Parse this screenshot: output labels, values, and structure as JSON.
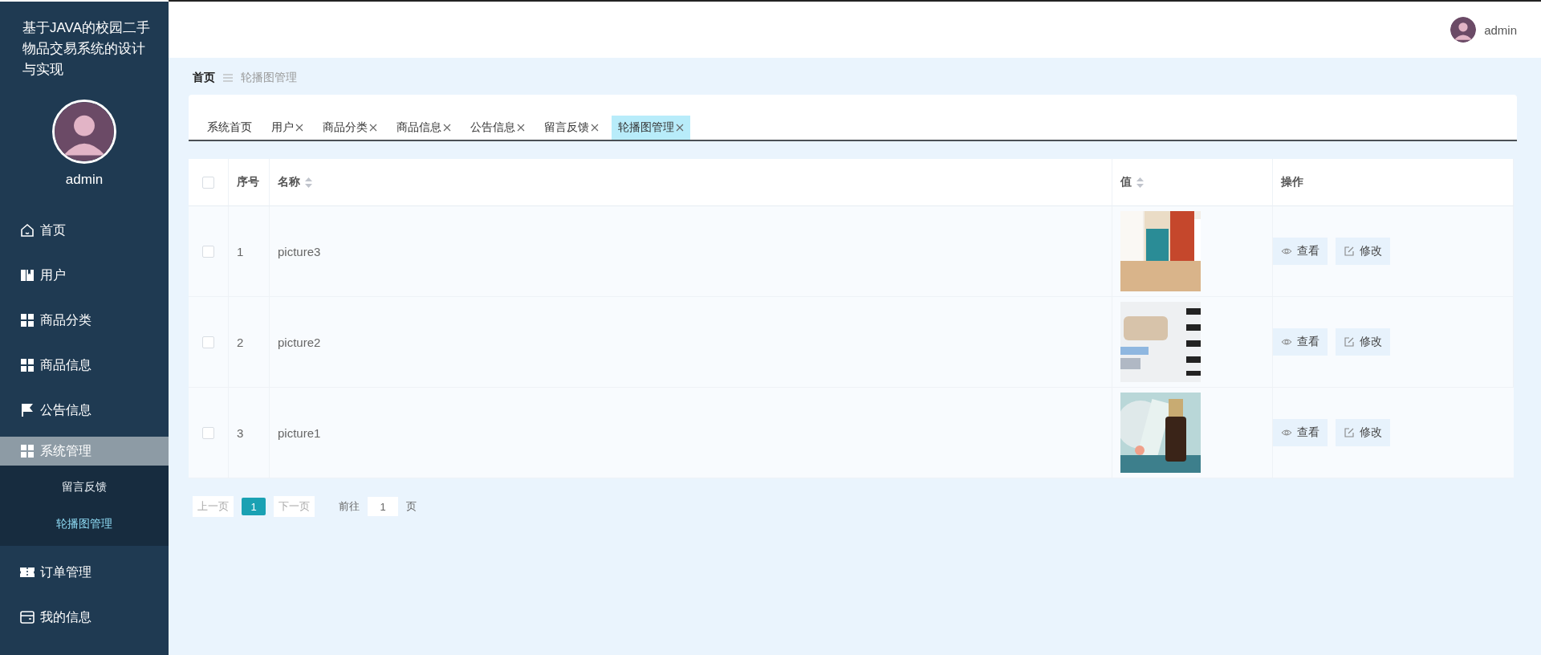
{
  "sidebar": {
    "title": "基于JAVA的校园二手物品交易系统的设计与实现",
    "user": {
      "name": "admin"
    },
    "menu": [
      {
        "label": "首页",
        "kind": "home",
        "selected": false
      },
      {
        "label": "用户",
        "kind": "book",
        "selected": false
      },
      {
        "label": "商品分类",
        "kind": "grid",
        "selected": false
      },
      {
        "label": "商品信息",
        "kind": "grid",
        "selected": false
      },
      {
        "label": "公告信息",
        "kind": "flag",
        "selected": false
      },
      {
        "label": "系统管理",
        "kind": "grid",
        "selected": true,
        "expanded": true,
        "children": [
          {
            "label": "留言反馈",
            "selected": false
          },
          {
            "label": "轮播图管理",
            "selected": true
          }
        ]
      },
      {
        "label": "订单管理",
        "kind": "ticket",
        "selected": false
      },
      {
        "label": "我的信息",
        "kind": "card",
        "selected": false
      }
    ]
  },
  "header": {
    "user": "admin"
  },
  "breadcrumb": [
    "首页",
    "轮播图管理"
  ],
  "tabs": [
    {
      "label": "系统首页",
      "closable": false,
      "selected": false
    },
    {
      "label": "用户",
      "closable": true,
      "selected": false
    },
    {
      "label": "商品分类",
      "closable": true,
      "selected": false
    },
    {
      "label": "商品信息",
      "closable": true,
      "selected": false
    },
    {
      "label": "公告信息",
      "closable": true,
      "selected": false
    },
    {
      "label": "留言反馈",
      "closable": true,
      "selected": false
    },
    {
      "label": "轮播图管理",
      "closable": true,
      "selected": true
    }
  ],
  "table": {
    "select_all": {
      "checked": false
    },
    "columns": [
      {
        "label": "序号",
        "sortable": false
      },
      {
        "label": "名称",
        "sortable": true
      },
      {
        "label": "值",
        "sortable": true
      },
      {
        "label": "操作",
        "sortable": false
      }
    ],
    "rows": [
      {
        "checked": false,
        "index": "1",
        "name": "picture3",
        "value": {
          "kind": "picture"
        },
        "actions": [
          {
            "kind": "view",
            "label": "查看"
          },
          {
            "kind": "edit",
            "label": "修改"
          }
        ]
      },
      {
        "checked": false,
        "index": "2",
        "name": "picture2",
        "value": {
          "kind": "picture"
        },
        "actions": [
          {
            "kind": "view",
            "label": "查看"
          },
          {
            "kind": "edit",
            "label": "修改"
          }
        ]
      },
      {
        "checked": false,
        "index": "3",
        "name": "picture1",
        "value": {
          "kind": "picture"
        },
        "actions": [
          {
            "kind": "view",
            "label": "查看"
          },
          {
            "kind": "edit",
            "label": "修改"
          }
        ]
      }
    ]
  },
  "pagination": {
    "prev": "上一页",
    "pages": [
      {
        "label": "1",
        "selected": true
      }
    ],
    "next": "下一页",
    "goto_label": "前往",
    "goto_value": "1",
    "goto_suffix": "页"
  }
}
